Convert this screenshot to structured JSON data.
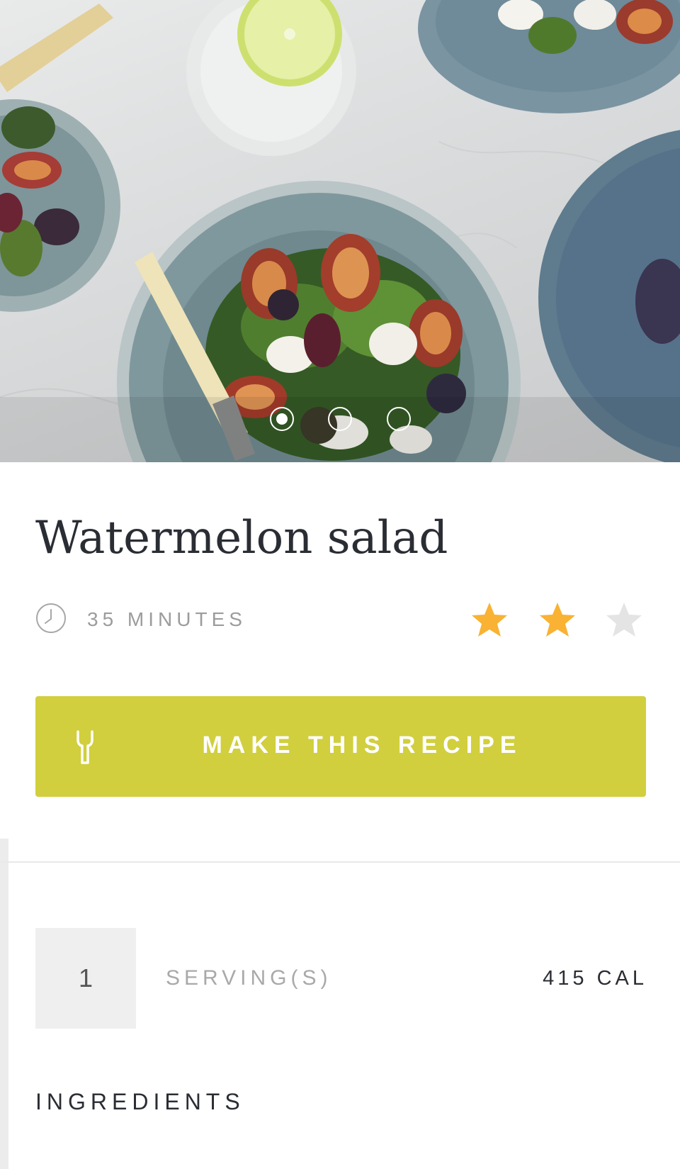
{
  "recipe": {
    "title": "Watermelon salad",
    "time_label": "35 MINUTES",
    "rating": 2,
    "rating_max": 3,
    "cta_label": "MAKE THIS RECIPE",
    "servings_value": "1",
    "servings_label": "SERVING(S)",
    "calories_label": "415 CAL",
    "ingredients_heading": "INGREDIENTS"
  },
  "carousel": {
    "slide_count": 3,
    "active_index": 0
  },
  "colors": {
    "accent": "#d1cf3d",
    "star_filled": "#f9b233",
    "star_empty": "#e4e4e4",
    "text_dark": "#2a2d33",
    "text_muted": "#9c9c9c"
  },
  "icons": {
    "clock": "clock-icon",
    "cta": "fork-icon",
    "rating": "star-icon"
  }
}
